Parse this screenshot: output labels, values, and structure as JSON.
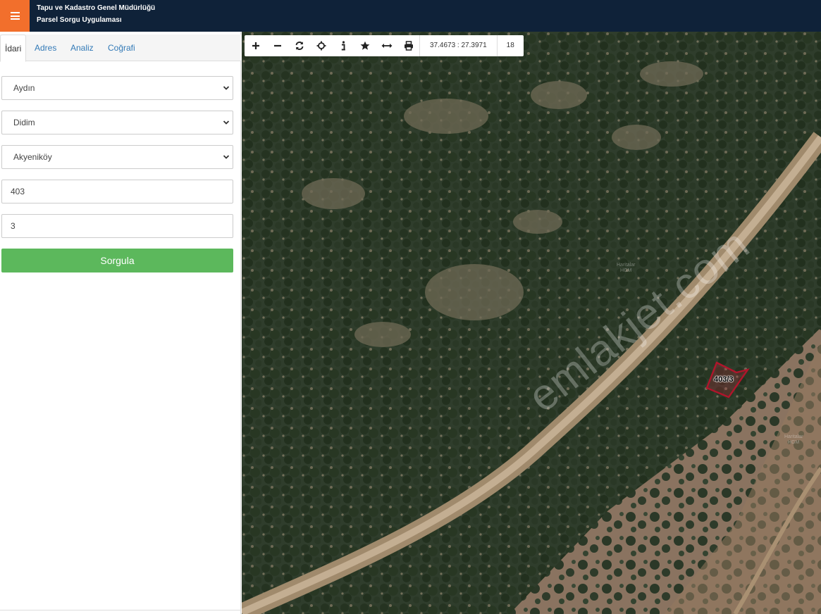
{
  "app": {
    "title_line1": "Tapu ve Kadastro Genel Müdürlüğü",
    "title_line2": "Parsel Sorgu Uygulaması",
    "menu_icon": "hamburger-icon",
    "accent_color": "#f26f2c",
    "header_color": "#0f2239"
  },
  "tabs": [
    {
      "label": "İdari",
      "active": true
    },
    {
      "label": "Adres",
      "active": false
    },
    {
      "label": "Analiz",
      "active": false
    },
    {
      "label": "Coğrafi",
      "active": false
    }
  ],
  "form": {
    "il": "Aydın",
    "ilce": "Didim",
    "mahalle": "Akyeniköy",
    "ada": "403",
    "parsel": "3",
    "submit_label": "Sorgula",
    "submit_color": "#5cb85c"
  },
  "map": {
    "toolbar_icons": [
      "zoom-in-icon",
      "zoom-out-icon",
      "refresh-icon",
      "locate-icon",
      "info-icon",
      "star-icon",
      "measure-icon",
      "print-icon"
    ],
    "coordinates": "37.4673 : 27.3971",
    "zoom_level": "18",
    "parcel_label": "403/3",
    "watermark": "emlakjet.com",
    "rgm_label_line1": "Haritalar",
    "rgm_label_line2": "HGM"
  }
}
